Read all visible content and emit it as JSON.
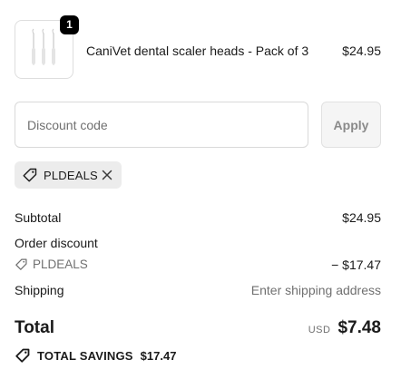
{
  "line_item": {
    "quantity": "1",
    "name": "CaniVet dental scaler heads - Pack of 3",
    "price": "$24.95",
    "image_icon": "dental-scaler-heads-image"
  },
  "discount_form": {
    "placeholder": "Discount code",
    "value": "",
    "apply_label": "Apply"
  },
  "applied_code": {
    "code": "PLDEALS",
    "icon": "tag-icon",
    "remove_icon": "close-icon"
  },
  "summary": {
    "subtotal_label": "Subtotal",
    "subtotal_value": "$24.95",
    "order_discount_label": "Order discount",
    "discount_code": "PLDEALS",
    "discount_value": "− $17.47",
    "shipping_label": "Shipping",
    "shipping_value": "Enter shipping address"
  },
  "total": {
    "label": "Total",
    "currency": "USD",
    "amount": "$7.48"
  },
  "savings": {
    "label": "TOTAL SAVINGS",
    "amount": "$17.47"
  }
}
